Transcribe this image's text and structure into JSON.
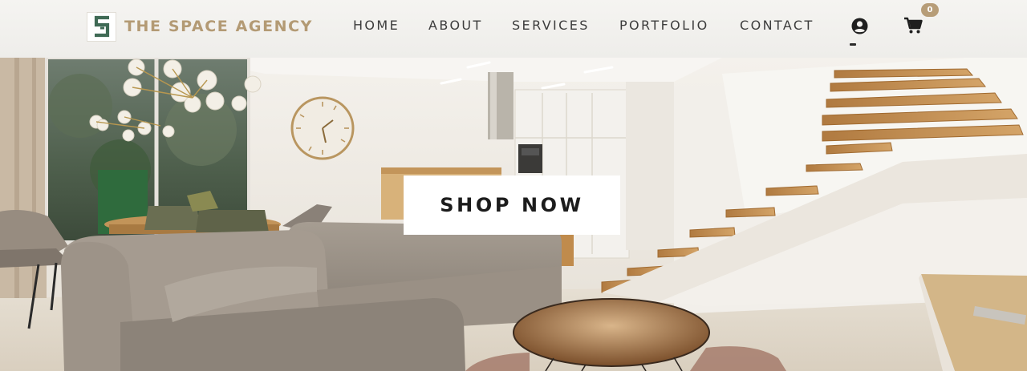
{
  "brand": {
    "name": "THE SPACE AGENCY",
    "logo_icon": "s-monogram-logo-icon",
    "colors": {
      "brand_gold": "#b39a74",
      "logo_green": "#3f6a55"
    }
  },
  "nav": {
    "items": [
      {
        "label": "HOME"
      },
      {
        "label": "ABOUT"
      },
      {
        "label": "SERVICES"
      },
      {
        "label": "PORTFOLIO"
      },
      {
        "label": "CONTACT"
      }
    ],
    "account_icon": "user-circle-icon",
    "cart_icon": "shopping-cart-icon",
    "cart_count": "0",
    "colors": {
      "badge": "#b79d78",
      "text": "#3c3c3c"
    }
  },
  "hero": {
    "image_subject": "modern-living-room-photo",
    "cta_label": "SHOP NOW"
  }
}
